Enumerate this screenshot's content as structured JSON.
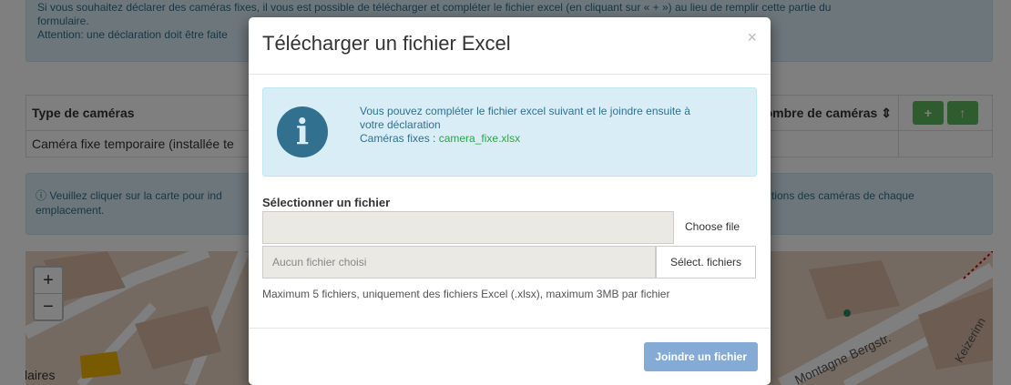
{
  "background": {
    "alert_top_lines": [
      "Si vous souhaitez déclarer des caméras fixes, il vous est possible de télécharger et compléter le fichier excel (en cliquant sur « + ») au lieu de remplir cette partie du",
      "formulaire.",
      "Attention: une déclaration doit être faite"
    ],
    "table": {
      "col_type": "Type de caméras",
      "col_count": "Nombre de caméras",
      "row1_type": "Caméra fixe temporaire (installée te",
      "add_label": "+",
      "up_label": "↑"
    },
    "alert_mid_left": "Veuillez cliquer sur la carte pour ind",
    "alert_mid_right": "tions des caméras de chaque",
    "alert_mid_line2": "emplacement.",
    "map_labels": {
      "left": "s Claires",
      "right_street": "Montagne Bergstr.",
      "right_street2": "Keizerinn"
    },
    "zoom_in": "+",
    "zoom_out": "−"
  },
  "modal": {
    "title": "Télécharger un fichier Excel",
    "close": "×",
    "info_line1": "Vous pouvez compléter le fichier excel suivant et le joindre ensuite à",
    "info_line2": "votre déclaration",
    "info_files_prefix": "Caméras fixes : ",
    "info_file_link": "camera_fixe.xlsx",
    "info_icon": "i",
    "label": "Sélectionner un fichier",
    "choose_file": "Choose file",
    "file_placeholder": "Aucun fichier choisi",
    "select_button": "Sélect. fichiers",
    "help": "Maximum 5 fichiers, uniquement des fichiers Excel (.xlsx), maximum 3MB par fichier",
    "submit": "Joindre un fichier"
  },
  "colors": {
    "info_bg": "#d9edf7",
    "info_text": "#31708f",
    "primary_disabled": "#84abd6",
    "link_green": "#28a745"
  }
}
